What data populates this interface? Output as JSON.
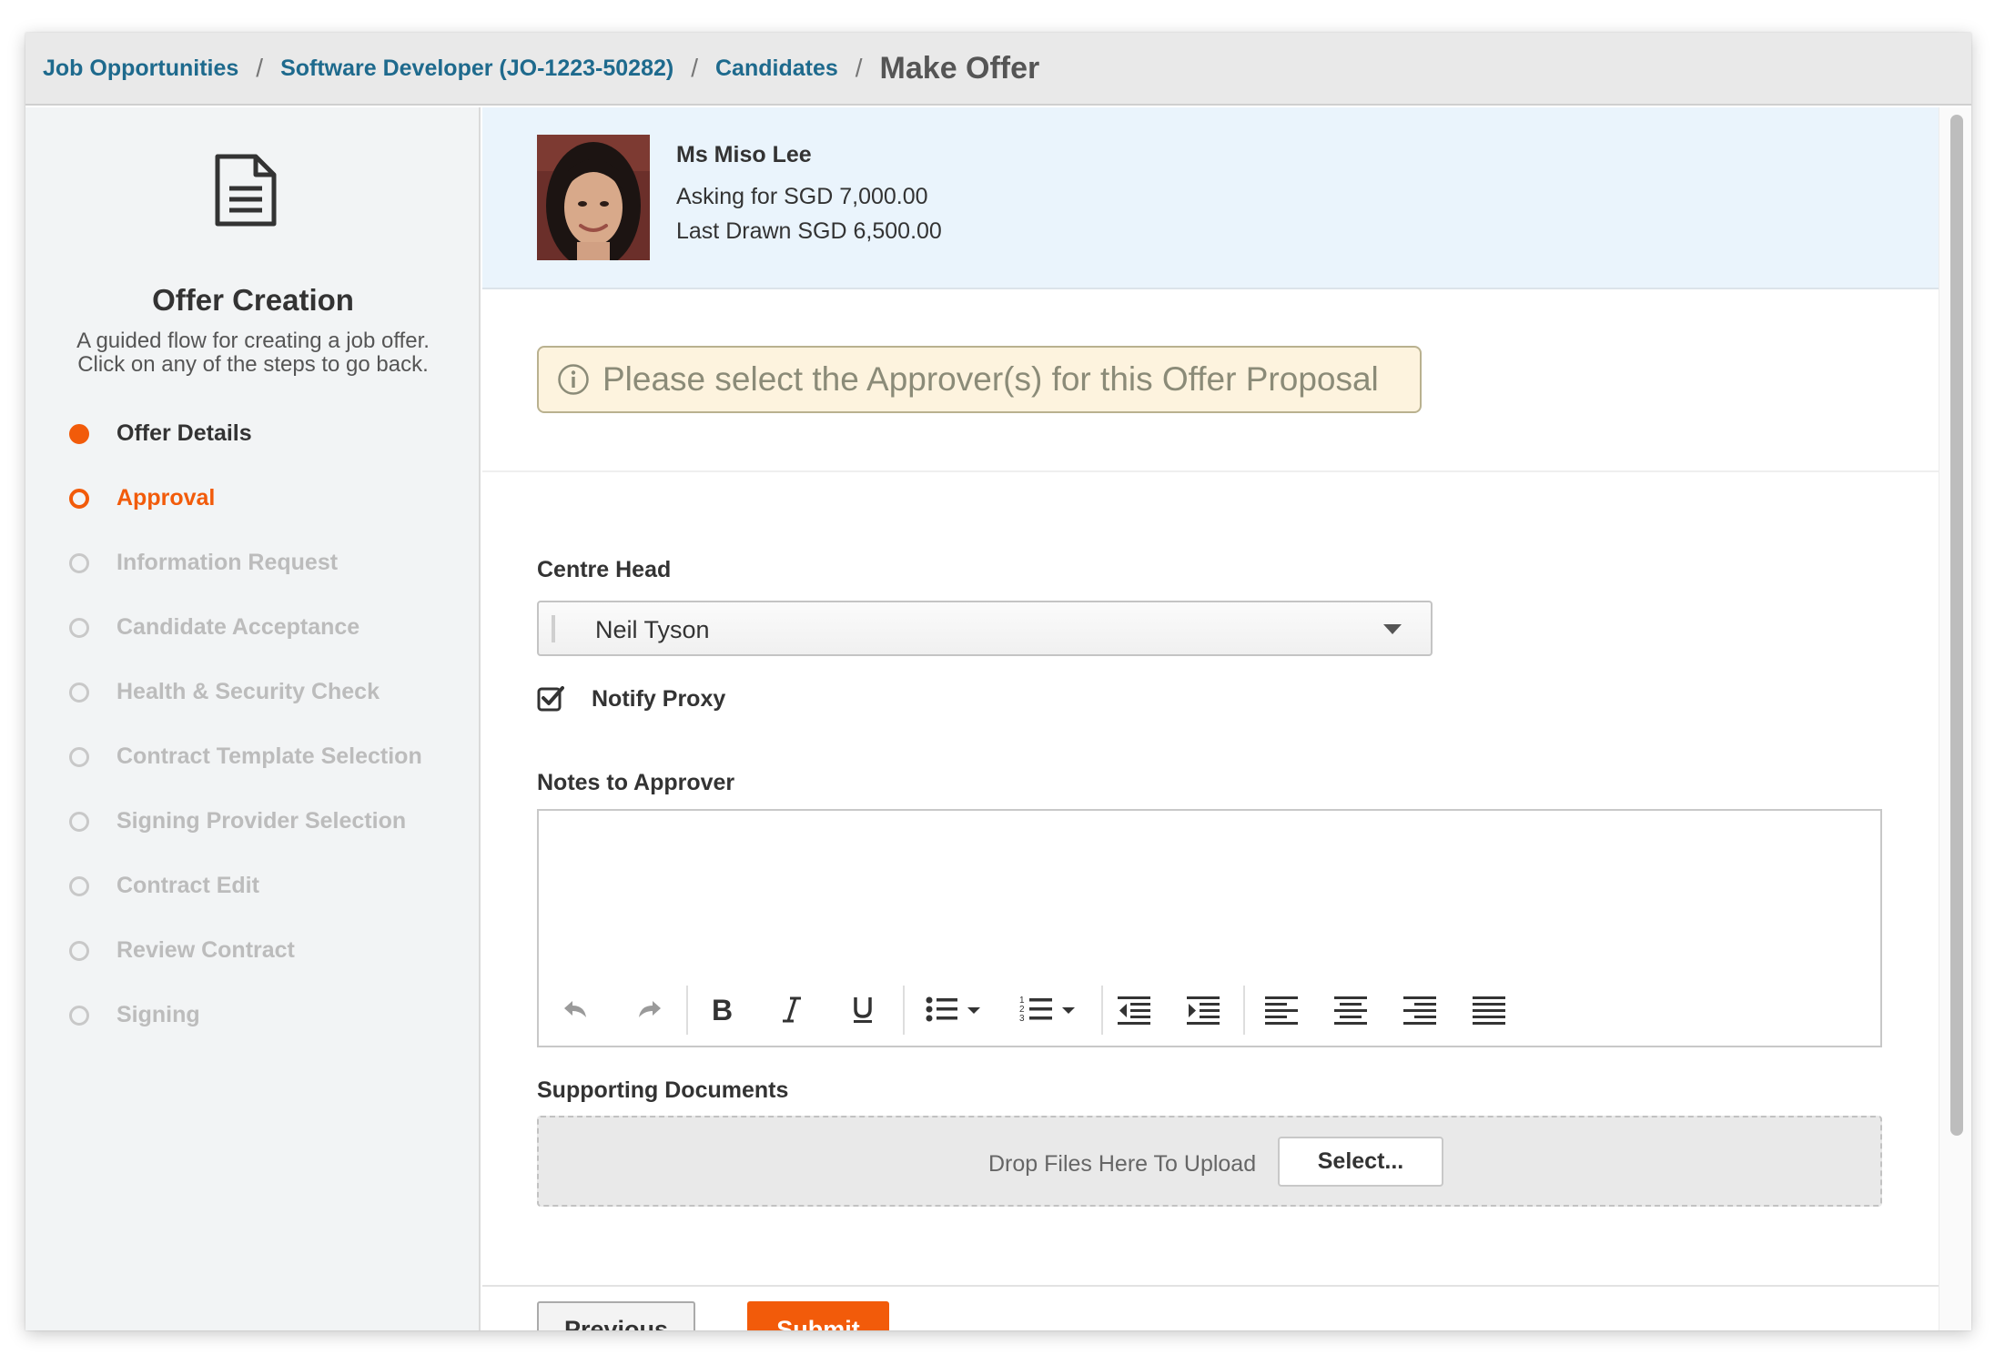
{
  "breadcrumb": {
    "items": [
      "Job Opportunities",
      "Software Developer (JO-1223-50282)",
      "Candidates"
    ],
    "separator": "/",
    "current": "Make Offer"
  },
  "sidebar": {
    "title": "Offer Creation",
    "description": "A guided flow for creating a job offer. Click on any of the steps to go back.",
    "steps": [
      {
        "label": "Offer Details",
        "state": "done"
      },
      {
        "label": "Approval",
        "state": "active"
      },
      {
        "label": "Information Request",
        "state": "pending"
      },
      {
        "label": "Candidate Acceptance",
        "state": "pending"
      },
      {
        "label": "Health & Security Check",
        "state": "pending"
      },
      {
        "label": "Contract Template Selection",
        "state": "pending"
      },
      {
        "label": "Signing Provider Selection",
        "state": "pending"
      },
      {
        "label": "Contract Edit",
        "state": "pending"
      },
      {
        "label": "Review Contract",
        "state": "pending"
      },
      {
        "label": "Signing",
        "state": "pending"
      }
    ]
  },
  "candidate": {
    "name": "Ms Miso Lee",
    "asking": "Asking for SGD 7,000.00",
    "last_drawn": "Last Drawn SGD 6,500.00"
  },
  "notice": {
    "text": "Please select the Approver(s) for this Offer Proposal",
    "icon": "info-icon"
  },
  "form": {
    "centre_head_label": "Centre Head",
    "centre_head_value": "Neil Tyson",
    "notify_proxy_label": "Notify Proxy",
    "notify_proxy_checked": true,
    "notes_label": "Notes to Approver",
    "notes_value": "",
    "supporting_docs_label": "Supporting Documents",
    "drop_text": "Drop Files Here To Upload",
    "select_label": "Select..."
  },
  "editor_toolbar": [
    "undo-icon",
    "redo-icon",
    "bold-icon",
    "italic-icon",
    "underline-icon",
    "bullet-list-icon",
    "numbered-list-icon",
    "outdent-icon",
    "indent-icon",
    "align-left-icon",
    "align-center-icon",
    "align-right-icon",
    "align-justify-icon"
  ],
  "actions": {
    "previous": "Previous",
    "submit": "Submit"
  },
  "colors": {
    "accent": "#f25b0a",
    "link": "#1e6a8d",
    "notice_bg": "#fdf3de",
    "candidate_bg": "#eaf4fc"
  }
}
